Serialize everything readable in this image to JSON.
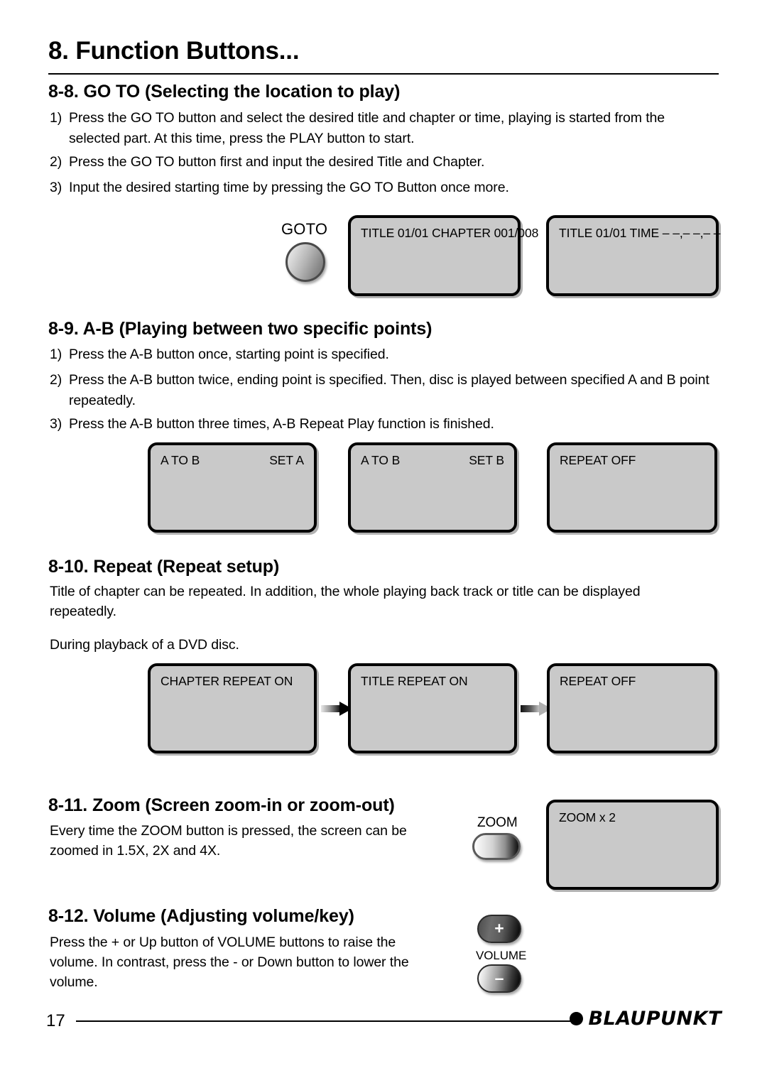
{
  "document": {
    "main_title": "8. Function Buttons...",
    "page_number": "17",
    "brand": "BLAUPUNKT"
  },
  "sections": [
    {
      "id": "goto",
      "heading": "8-8. GO TO (Selecting the location to play)",
      "steps": [
        {
          "num": "1)",
          "text": "Press the GO TO button and select the desired title and chapter or time, playing is started from the selected part. At this time, press the PLAY button to start."
        },
        {
          "num": "2)",
          "text": "Press the GO TO button first and input the desired Title and Chapter."
        },
        {
          "num": "3)",
          "text": "Input the desired starting time by pressing the GO TO Button once more."
        }
      ],
      "button": {
        "label": "GOTO",
        "icon": "round-button-icon"
      },
      "panels": [
        {
          "left": "TITLE 01/01 CHAPTER 001/008",
          "right": ""
        },
        {
          "left": "TITLE 01/01 TIME – –,– –,– –",
          "right": ""
        }
      ]
    },
    {
      "id": "ab",
      "heading": "8-9. A-B (Playing between two specific points)",
      "steps": [
        {
          "num": "1)",
          "text": "Press the A-B button once, starting point is specified."
        },
        {
          "num": "2)",
          "text": "Press the A-B button twice, ending point is specified. Then, disc is played between specified A and B point repeatedly."
        },
        {
          "num": "3)",
          "text": "Press the A-B button three times, A-B Repeat Play function is finished."
        }
      ],
      "panels": [
        {
          "left": "A TO B",
          "right": "SET A"
        },
        {
          "left": "A TO B",
          "right": "SET B"
        },
        {
          "left": "REPEAT OFF",
          "right": ""
        }
      ]
    },
    {
      "id": "repeat",
      "heading": "8-10. Repeat (Repeat setup)",
      "paragraphs": [
        "Title of chapter can be repeated.  In addition, the whole playing back track or title can be displayed repeatedly.",
        "During playback of a DVD disc."
      ],
      "panels": [
        {
          "left": "CHAPTER REPEAT ON",
          "right": ""
        },
        {
          "left": "TITLE REPEAT ON",
          "right": ""
        },
        {
          "left": "REPEAT OFF",
          "right": ""
        }
      ],
      "arrows": [
        "arrow-right-icon",
        "arrow-right-icon"
      ]
    },
    {
      "id": "zoom",
      "heading": "8-11. Zoom (Screen zoom-in or zoom-out)",
      "paragraphs": [
        "Every time the ZOOM button is pressed, the screen can be zoomed in 1.5X, 2X and 4X."
      ],
      "button": {
        "label": "ZOOM",
        "icon": "pill-button-icon"
      },
      "panels": [
        {
          "left": "ZOOM x 2",
          "right": ""
        }
      ]
    },
    {
      "id": "volume",
      "heading": "8-12. Volume (Adjusting volume/key)",
      "paragraphs": [
        "Press the  +  or Up button of VOLUME buttons to raise the volume.  In contrast, press the  -  or Down button to lower the volume."
      ],
      "buttons": {
        "plus": "+",
        "minus": "–",
        "label": "VOLUME"
      }
    }
  ],
  "colors": {
    "panel_fill": "#c9c9c9",
    "panel_border": "#000000",
    "text": "#000000",
    "page_background": "#ffffff"
  }
}
